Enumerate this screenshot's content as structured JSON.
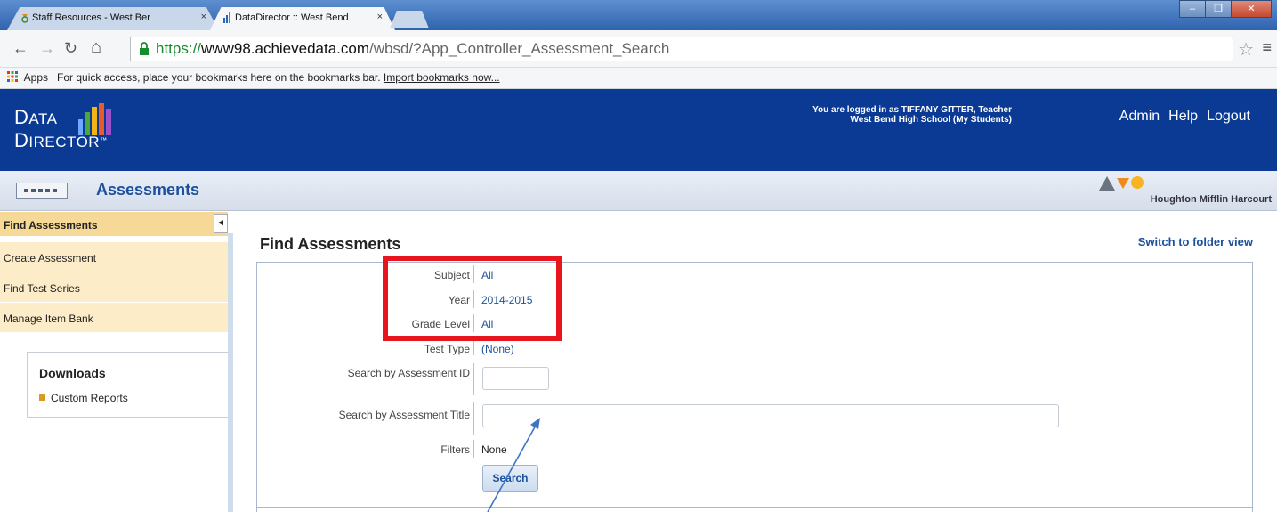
{
  "browser": {
    "tabs": [
      {
        "title": "Staff Resources - West Ber",
        "close": "×"
      },
      {
        "title": "DataDirector :: West Bend",
        "close": "×"
      }
    ],
    "url": {
      "scheme": "https://",
      "host": "www98.achievedata.com",
      "path": "/wbsd/?App_Controller_Assessment_Search"
    },
    "bookmarks": {
      "apps": "Apps",
      "hint": "For quick access, place your bookmarks here on the bookmarks bar.",
      "import": "Import bookmarks now..."
    }
  },
  "header": {
    "logo_line1_big": "D",
    "logo_line1": "ATA",
    "logo_line2_big": "D",
    "logo_line2": "IRECTOR",
    "logo_tm": "™",
    "login_line1": "You are logged in as TIFFANY GITTER, Teacher",
    "login_line2": "West Bend High School (My Students)",
    "nav": [
      "Admin",
      "Help",
      "Logout"
    ]
  },
  "subheader": {
    "title": "Assessments",
    "brand": "Houghton Mifflin Harcourt"
  },
  "sidebar": {
    "items": [
      {
        "label": "Find Assessments"
      },
      {
        "label": "Create Assessment"
      },
      {
        "label": "Find Test Series"
      },
      {
        "label": "Manage Item Bank"
      }
    ],
    "collapse": "◄",
    "downloads": {
      "heading": "Downloads",
      "items": [
        "Custom Reports"
      ]
    }
  },
  "main": {
    "title": "Find Assessments",
    "switch_link": "Switch to folder view",
    "fields": {
      "subject": {
        "label": "Subject",
        "value": "All"
      },
      "year": {
        "label": "Year",
        "value": "2014-2015"
      },
      "grade": {
        "label": "Grade Level",
        "value": "All"
      },
      "test_type": {
        "label": "Test Type",
        "value": "(None)"
      },
      "assessment_id": {
        "label": "Search by Assessment ID",
        "value": ""
      },
      "assessment_title": {
        "label": "Search by Assessment Title",
        "value": ""
      },
      "filters": {
        "label": "Filters",
        "value": "None"
      }
    },
    "search_button": "Search"
  },
  "colors": {
    "header_blue": "#0b3a94",
    "link_blue": "#1c4f9c",
    "highlight_red": "#e8141e",
    "sidebar_tan": "#fcecc8"
  }
}
